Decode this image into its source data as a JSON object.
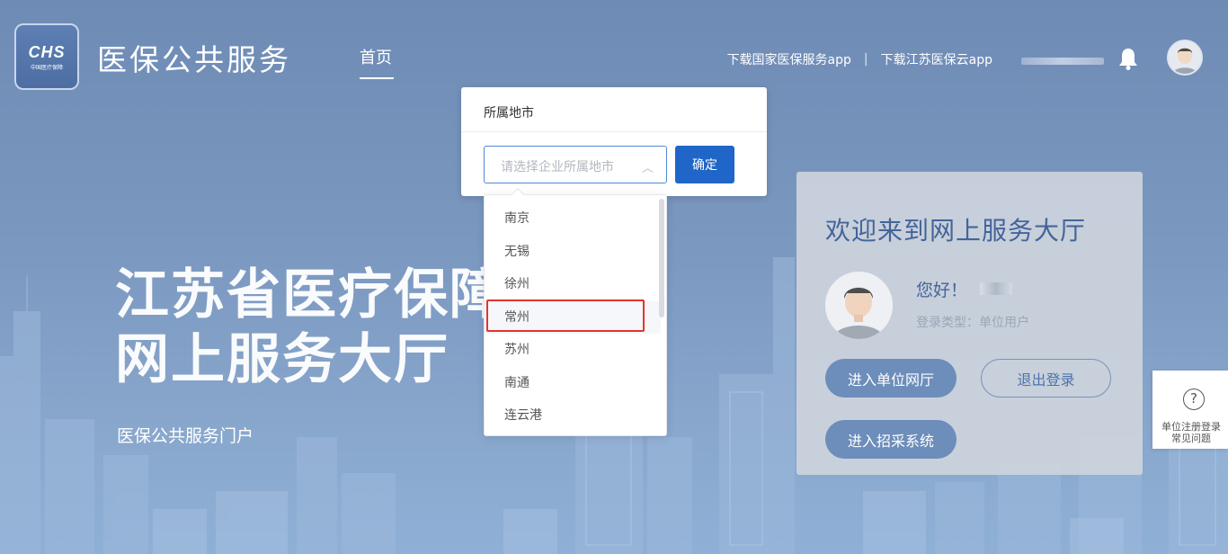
{
  "header": {
    "logo_text": "CHS",
    "logo_subtext": "中国医疗保障",
    "site_title": "医保公共服务",
    "nav_home": "首页",
    "link_national_app": "下载国家医保服务app",
    "separator": "|",
    "link_jiangsu_app": "下载江苏医保云app"
  },
  "hero": {
    "title_line1": "江苏省医疗保障",
    "title_line2": "网上服务大厅",
    "subtitle": "医保公共服务门户"
  },
  "city_popup": {
    "title": "所属地市",
    "select_placeholder": "请选择企业所属地市",
    "confirm_label": "确定",
    "options": [
      "南京",
      "无锡",
      "徐州",
      "常州",
      "苏州",
      "南通",
      "连云港"
    ],
    "highlighted_option": "常州"
  },
  "welcome_panel": {
    "title": "欢迎来到网上服务大厅",
    "greeting": "您好！",
    "login_type": "登录类型：单位用户",
    "enter_unit_hall": "进入单位网厅",
    "logout": "退出登录",
    "enter_procurement": "进入招采系统"
  },
  "help_widget": {
    "icon": "?",
    "label_line1": "单位注册登录",
    "label_line2": "常见问题"
  },
  "colors": {
    "background": "#7b98c0",
    "primary_button": "#1f66c8",
    "highlight_border": "#e5322d",
    "welcome_text": "#44649a"
  }
}
